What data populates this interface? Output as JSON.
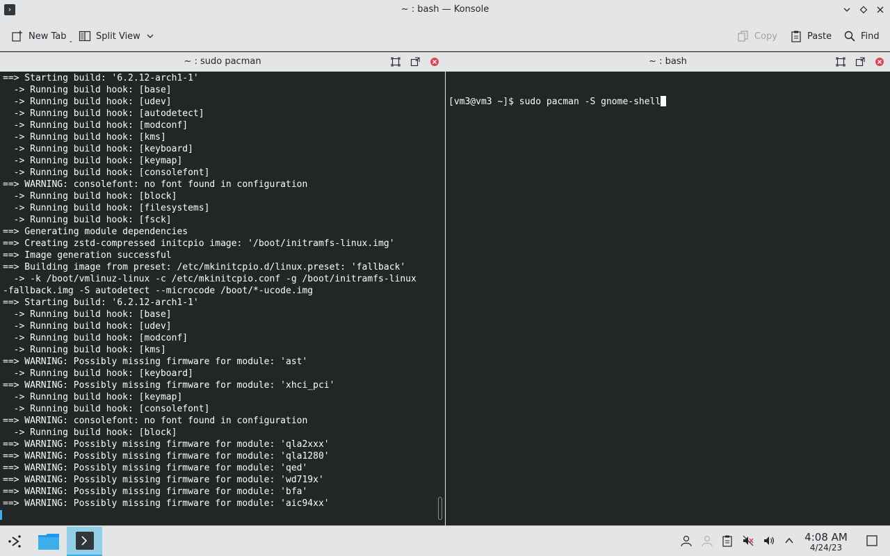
{
  "window": {
    "title": "~ : bash — Konsole",
    "app_icon": "terminal-icon"
  },
  "toolbar": {
    "new_tab": "New Tab",
    "split_view": "Split View",
    "copy": "Copy",
    "paste": "Paste",
    "find": "Find"
  },
  "left_pane": {
    "title": "~ : sudo pacman",
    "lines": [
      "==> Starting build: '6.2.12-arch1-1'",
      "  -> Running build hook: [base]",
      "  -> Running build hook: [udev]",
      "  -> Running build hook: [autodetect]",
      "  -> Running build hook: [modconf]",
      "  -> Running build hook: [kms]",
      "  -> Running build hook: [keyboard]",
      "  -> Running build hook: [keymap]",
      "  -> Running build hook: [consolefont]",
      "==> WARNING: consolefont: no font found in configuration",
      "  -> Running build hook: [block]",
      "  -> Running build hook: [filesystems]",
      "  -> Running build hook: [fsck]",
      "==> Generating module dependencies",
      "==> Creating zstd-compressed initcpio image: '/boot/initramfs-linux.img'",
      "==> Image generation successful",
      "==> Building image from preset: /etc/mkinitcpio.d/linux.preset: 'fallback'",
      "  -> -k /boot/vmlinuz-linux -c /etc/mkinitcpio.conf -g /boot/initramfs-linux",
      "-fallback.img -S autodetect --microcode /boot/*-ucode.img",
      "==> Starting build: '6.2.12-arch1-1'",
      "  -> Running build hook: [base]",
      "  -> Running build hook: [udev]",
      "  -> Running build hook: [modconf]",
      "  -> Running build hook: [kms]",
      "==> WARNING: Possibly missing firmware for module: 'ast'",
      "  -> Running build hook: [keyboard]",
      "==> WARNING: Possibly missing firmware for module: 'xhci_pci'",
      "  -> Running build hook: [keymap]",
      "  -> Running build hook: [consolefont]",
      "==> WARNING: consolefont: no font found in configuration",
      "  -> Running build hook: [block]",
      "==> WARNING: Possibly missing firmware for module: 'qla2xxx'",
      "==> WARNING: Possibly missing firmware for module: 'qla1280'",
      "==> WARNING: Possibly missing firmware for module: 'qed'",
      "==> WARNING: Possibly missing firmware for module: 'wd719x'",
      "==> WARNING: Possibly missing firmware for module: 'bfa'",
      "==> WARNING: Possibly missing firmware for module: 'aic94xx'"
    ]
  },
  "right_pane": {
    "title": "~ : bash",
    "prompt": "[vm3@vm3 ~]$ sudo pacman -S gnome-shell"
  },
  "taskbar": {
    "time": "4:08 AM",
    "date": "4/24/23"
  },
  "colors": {
    "terminal_bg": "#232627",
    "terminal_fg": "#fcfcfc",
    "chrome_bg": "#e3e5e7",
    "accent": "#3daee9"
  }
}
